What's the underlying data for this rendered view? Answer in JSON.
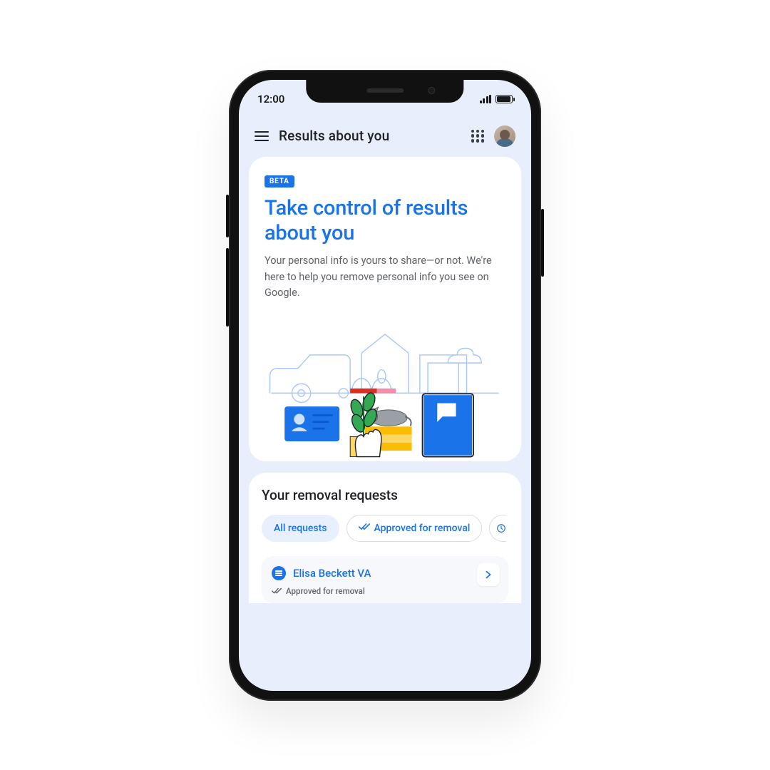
{
  "statusbar": {
    "time": "12:00"
  },
  "appbar": {
    "title": "Results about you"
  },
  "hero": {
    "badge": "BETA",
    "title": "Take control of results about you",
    "subtitle": "Your personal info is yours to share—or not. We're here to help you remove personal info you see on Google."
  },
  "requests": {
    "heading": "Your removal requests",
    "chips": {
      "all": "All requests",
      "approved": "Approved for removal"
    },
    "item": {
      "name": "Elisa Beckett VA",
      "status": "Approved for removal"
    }
  }
}
